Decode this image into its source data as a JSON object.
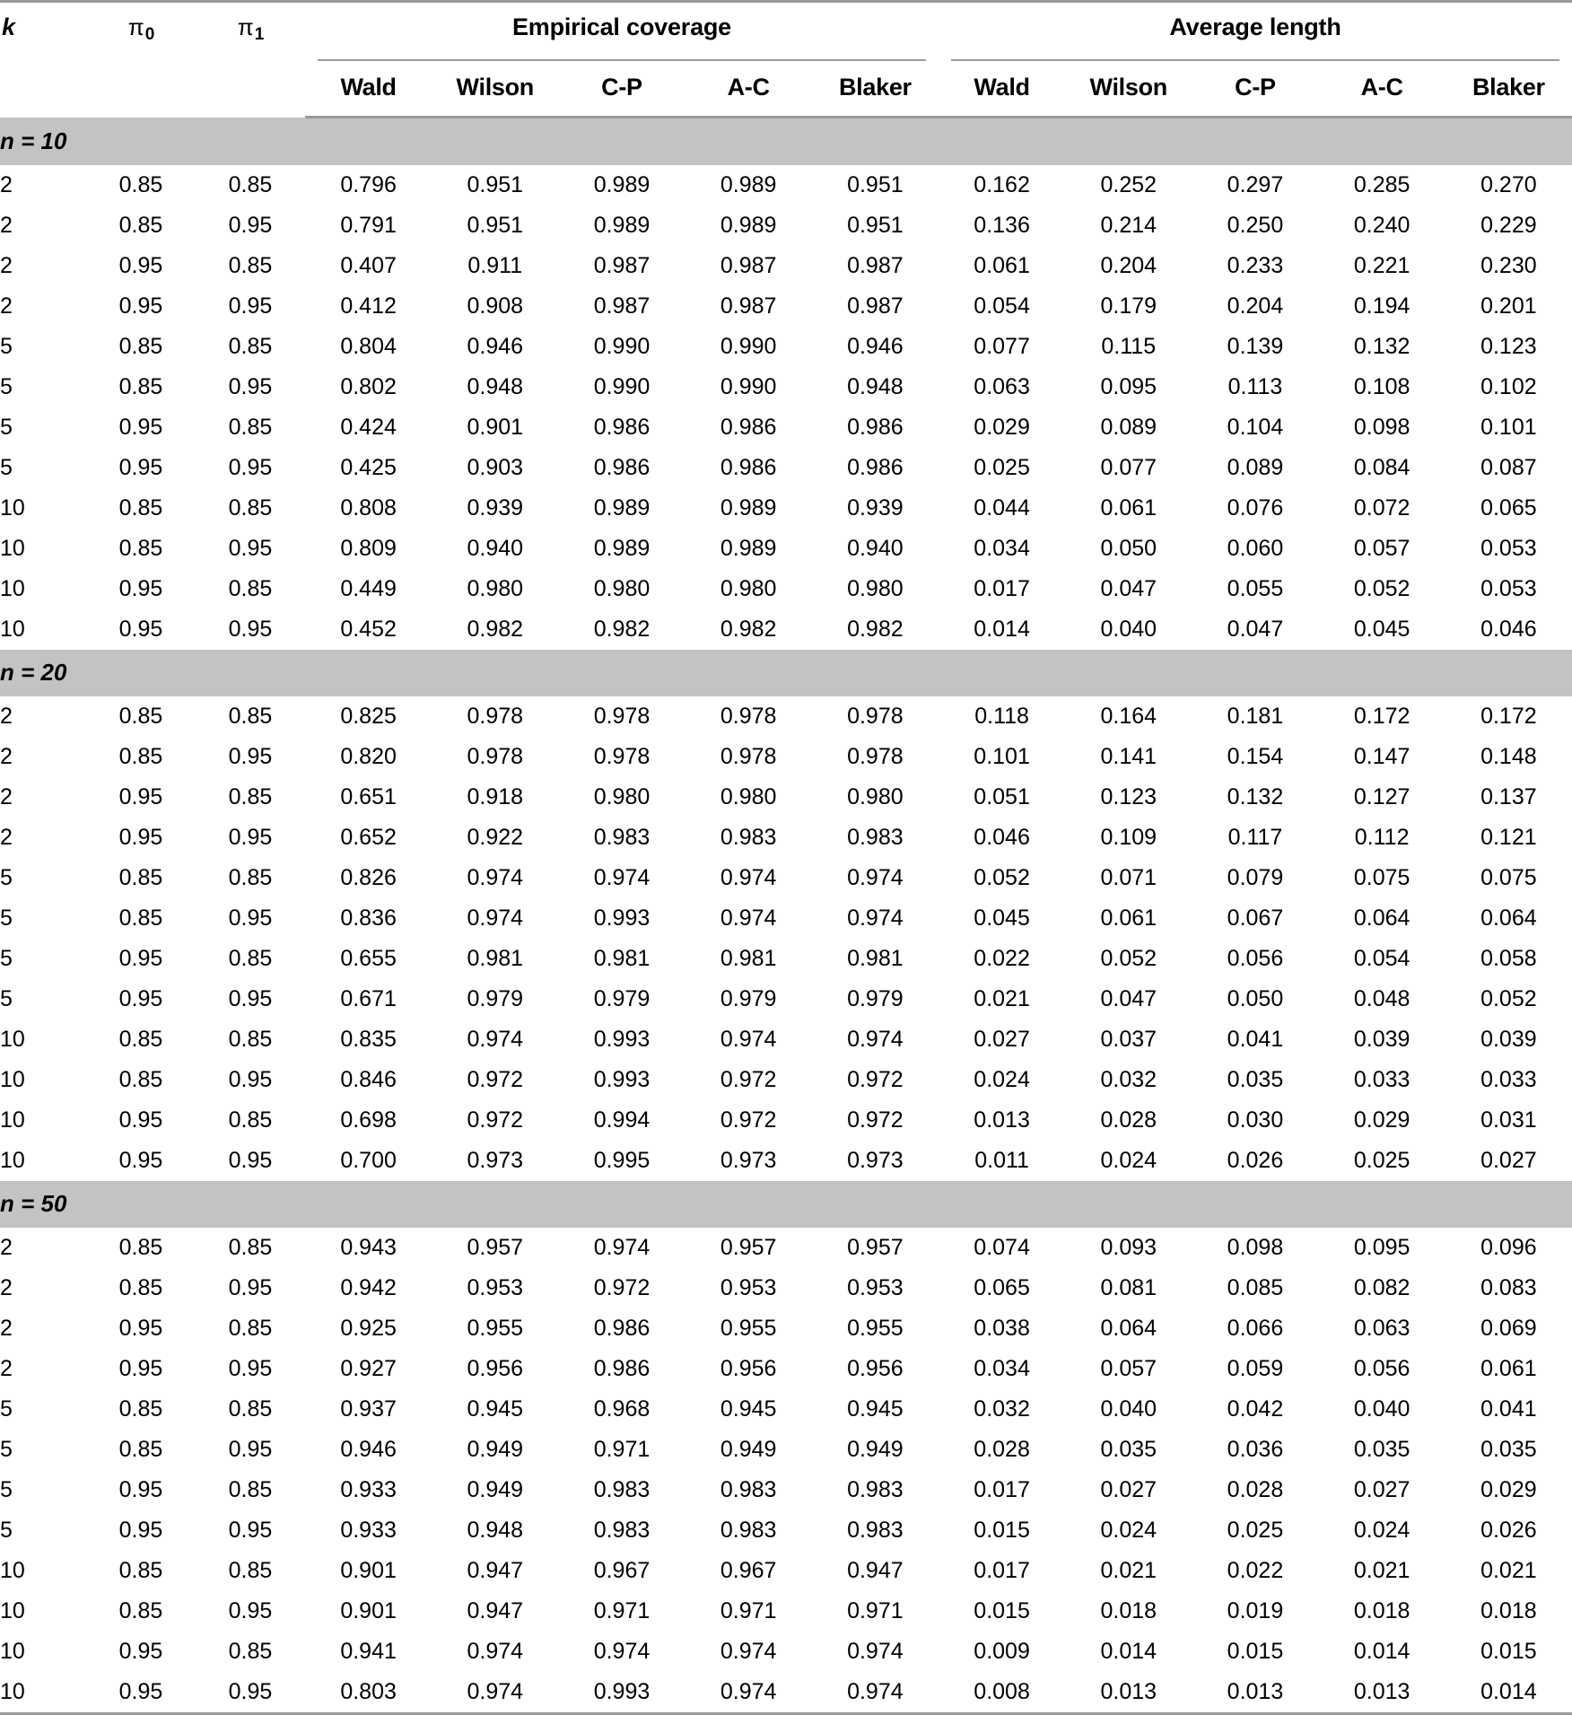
{
  "table": {
    "stub_headers": [
      {
        "label": "k",
        "style": "italic"
      },
      {
        "label": "π",
        "sub": "0"
      },
      {
        "label": "π",
        "sub": "1"
      }
    ],
    "group_headers": [
      {
        "label": "Empirical coverage",
        "span": 5
      },
      {
        "label": "Average length",
        "span": 5
      }
    ],
    "method_headers": [
      "Wald",
      "Wilson",
      "C-P",
      "A-C",
      "Blaker",
      "Wald",
      "Wilson",
      "C-P",
      "A-C",
      "Blaker"
    ],
    "colors": {
      "section_band": "#c3c3c3",
      "rule": "#9a9a9a",
      "text": "#000000",
      "background": "#ffffff"
    },
    "sections": [
      {
        "label": "n = 10",
        "label_var": "n",
        "label_value": "10",
        "rows": [
          {
            "k": "2",
            "p0": "0.85",
            "p1": "0.85",
            "cov": [
              "0.796",
              "0.951",
              "0.989",
              "0.989",
              "0.951"
            ],
            "len": [
              "0.162",
              "0.252",
              "0.297",
              "0.285",
              "0.270"
            ]
          },
          {
            "k": "2",
            "p0": "0.85",
            "p1": "0.95",
            "cov": [
              "0.791",
              "0.951",
              "0.989",
              "0.989",
              "0.951"
            ],
            "len": [
              "0.136",
              "0.214",
              "0.250",
              "0.240",
              "0.229"
            ]
          },
          {
            "k": "2",
            "p0": "0.95",
            "p1": "0.85",
            "cov": [
              "0.407",
              "0.911",
              "0.987",
              "0.987",
              "0.987"
            ],
            "len": [
              "0.061",
              "0.204",
              "0.233",
              "0.221",
              "0.230"
            ]
          },
          {
            "k": "2",
            "p0": "0.95",
            "p1": "0.95",
            "cov": [
              "0.412",
              "0.908",
              "0.987",
              "0.987",
              "0.987"
            ],
            "len": [
              "0.054",
              "0.179",
              "0.204",
              "0.194",
              "0.201"
            ]
          },
          {
            "k": "5",
            "p0": "0.85",
            "p1": "0.85",
            "cov": [
              "0.804",
              "0.946",
              "0.990",
              "0.990",
              "0.946"
            ],
            "len": [
              "0.077",
              "0.115",
              "0.139",
              "0.132",
              "0.123"
            ]
          },
          {
            "k": "5",
            "p0": "0.85",
            "p1": "0.95",
            "cov": [
              "0.802",
              "0.948",
              "0.990",
              "0.990",
              "0.948"
            ],
            "len": [
              "0.063",
              "0.095",
              "0.113",
              "0.108",
              "0.102"
            ]
          },
          {
            "k": "5",
            "p0": "0.95",
            "p1": "0.85",
            "cov": [
              "0.424",
              "0.901",
              "0.986",
              "0.986",
              "0.986"
            ],
            "len": [
              "0.029",
              "0.089",
              "0.104",
              "0.098",
              "0.101"
            ]
          },
          {
            "k": "5",
            "p0": "0.95",
            "p1": "0.95",
            "cov": [
              "0.425",
              "0.903",
              "0.986",
              "0.986",
              "0.986"
            ],
            "len": [
              "0.025",
              "0.077",
              "0.089",
              "0.084",
              "0.087"
            ]
          },
          {
            "k": "10",
            "p0": "0.85",
            "p1": "0.85",
            "cov": [
              "0.808",
              "0.939",
              "0.989",
              "0.989",
              "0.939"
            ],
            "len": [
              "0.044",
              "0.061",
              "0.076",
              "0.072",
              "0.065"
            ]
          },
          {
            "k": "10",
            "p0": "0.85",
            "p1": "0.95",
            "cov": [
              "0.809",
              "0.940",
              "0.989",
              "0.989",
              "0.940"
            ],
            "len": [
              "0.034",
              "0.050",
              "0.060",
              "0.057",
              "0.053"
            ]
          },
          {
            "k": "10",
            "p0": "0.95",
            "p1": "0.85",
            "cov": [
              "0.449",
              "0.980",
              "0.980",
              "0.980",
              "0.980"
            ],
            "len": [
              "0.017",
              "0.047",
              "0.055",
              "0.052",
              "0.053"
            ]
          },
          {
            "k": "10",
            "p0": "0.95",
            "p1": "0.95",
            "cov": [
              "0.452",
              "0.982",
              "0.982",
              "0.982",
              "0.982"
            ],
            "len": [
              "0.014",
              "0.040",
              "0.047",
              "0.045",
              "0.046"
            ]
          }
        ]
      },
      {
        "label": "n = 20",
        "label_var": "n",
        "label_value": "20",
        "rows": [
          {
            "k": "2",
            "p0": "0.85",
            "p1": "0.85",
            "cov": [
              "0.825",
              "0.978",
              "0.978",
              "0.978",
              "0.978"
            ],
            "len": [
              "0.118",
              "0.164",
              "0.181",
              "0.172",
              "0.172"
            ]
          },
          {
            "k": "2",
            "p0": "0.85",
            "p1": "0.95",
            "cov": [
              "0.820",
              "0.978",
              "0.978",
              "0.978",
              "0.978"
            ],
            "len": [
              "0.101",
              "0.141",
              "0.154",
              "0.147",
              "0.148"
            ]
          },
          {
            "k": "2",
            "p0": "0.95",
            "p1": "0.85",
            "cov": [
              "0.651",
              "0.918",
              "0.980",
              "0.980",
              "0.980"
            ],
            "len": [
              "0.051",
              "0.123",
              "0.132",
              "0.127",
              "0.137"
            ]
          },
          {
            "k": "2",
            "p0": "0.95",
            "p1": "0.95",
            "cov": [
              "0.652",
              "0.922",
              "0.983",
              "0.983",
              "0.983"
            ],
            "len": [
              "0.046",
              "0.109",
              "0.117",
              "0.112",
              "0.121"
            ]
          },
          {
            "k": "5",
            "p0": "0.85",
            "p1": "0.85",
            "cov": [
              "0.826",
              "0.974",
              "0.974",
              "0.974",
              "0.974"
            ],
            "len": [
              "0.052",
              "0.071",
              "0.079",
              "0.075",
              "0.075"
            ]
          },
          {
            "k": "5",
            "p0": "0.85",
            "p1": "0.95",
            "cov": [
              "0.836",
              "0.974",
              "0.993",
              "0.974",
              "0.974"
            ],
            "len": [
              "0.045",
              "0.061",
              "0.067",
              "0.064",
              "0.064"
            ]
          },
          {
            "k": "5",
            "p0": "0.95",
            "p1": "0.85",
            "cov": [
              "0.655",
              "0.981",
              "0.981",
              "0.981",
              "0.981"
            ],
            "len": [
              "0.022",
              "0.052",
              "0.056",
              "0.054",
              "0.058"
            ]
          },
          {
            "k": "5",
            "p0": "0.95",
            "p1": "0.95",
            "cov": [
              "0.671",
              "0.979",
              "0.979",
              "0.979",
              "0.979"
            ],
            "len": [
              "0.021",
              "0.047",
              "0.050",
              "0.048",
              "0.052"
            ]
          },
          {
            "k": "10",
            "p0": "0.85",
            "p1": "0.85",
            "cov": [
              "0.835",
              "0.974",
              "0.993",
              "0.974",
              "0.974"
            ],
            "len": [
              "0.027",
              "0.037",
              "0.041",
              "0.039",
              "0.039"
            ]
          },
          {
            "k": "10",
            "p0": "0.85",
            "p1": "0.95",
            "cov": [
              "0.846",
              "0.972",
              "0.993",
              "0.972",
              "0.972"
            ],
            "len": [
              "0.024",
              "0.032",
              "0.035",
              "0.033",
              "0.033"
            ]
          },
          {
            "k": "10",
            "p0": "0.95",
            "p1": "0.85",
            "cov": [
              "0.698",
              "0.972",
              "0.994",
              "0.972",
              "0.972"
            ],
            "len": [
              "0.013",
              "0.028",
              "0.030",
              "0.029",
              "0.031"
            ]
          },
          {
            "k": "10",
            "p0": "0.95",
            "p1": "0.95",
            "cov": [
              "0.700",
              "0.973",
              "0.995",
              "0.973",
              "0.973"
            ],
            "len": [
              "0.011",
              "0.024",
              "0.026",
              "0.025",
              "0.027"
            ]
          }
        ]
      },
      {
        "label": "n = 50",
        "label_var": "n",
        "label_value": "50",
        "rows": [
          {
            "k": "2",
            "p0": "0.85",
            "p1": "0.85",
            "cov": [
              "0.943",
              "0.957",
              "0.974",
              "0.957",
              "0.957"
            ],
            "len": [
              "0.074",
              "0.093",
              "0.098",
              "0.095",
              "0.096"
            ]
          },
          {
            "k": "2",
            "p0": "0.85",
            "p1": "0.95",
            "cov": [
              "0.942",
              "0.953",
              "0.972",
              "0.953",
              "0.953"
            ],
            "len": [
              "0.065",
              "0.081",
              "0.085",
              "0.082",
              "0.083"
            ]
          },
          {
            "k": "2",
            "p0": "0.95",
            "p1": "0.85",
            "cov": [
              "0.925",
              "0.955",
              "0.986",
              "0.955",
              "0.955"
            ],
            "len": [
              "0.038",
              "0.064",
              "0.066",
              "0.063",
              "0.069"
            ]
          },
          {
            "k": "2",
            "p0": "0.95",
            "p1": "0.95",
            "cov": [
              "0.927",
              "0.956",
              "0.986",
              "0.956",
              "0.956"
            ],
            "len": [
              "0.034",
              "0.057",
              "0.059",
              "0.056",
              "0.061"
            ]
          },
          {
            "k": "5",
            "p0": "0.85",
            "p1": "0.85",
            "cov": [
              "0.937",
              "0.945",
              "0.968",
              "0.945",
              "0.945"
            ],
            "len": [
              "0.032",
              "0.040",
              "0.042",
              "0.040",
              "0.041"
            ]
          },
          {
            "k": "5",
            "p0": "0.85",
            "p1": "0.95",
            "cov": [
              "0.946",
              "0.949",
              "0.971",
              "0.949",
              "0.949"
            ],
            "len": [
              "0.028",
              "0.035",
              "0.036",
              "0.035",
              "0.035"
            ]
          },
          {
            "k": "5",
            "p0": "0.95",
            "p1": "0.85",
            "cov": [
              "0.933",
              "0.949",
              "0.983",
              "0.983",
              "0.983"
            ],
            "len": [
              "0.017",
              "0.027",
              "0.028",
              "0.027",
              "0.029"
            ]
          },
          {
            "k": "5",
            "p0": "0.95",
            "p1": "0.95",
            "cov": [
              "0.933",
              "0.948",
              "0.983",
              "0.983",
              "0.983"
            ],
            "len": [
              "0.015",
              "0.024",
              "0.025",
              "0.024",
              "0.026"
            ]
          },
          {
            "k": "10",
            "p0": "0.85",
            "p1": "0.85",
            "cov": [
              "0.901",
              "0.947",
              "0.967",
              "0.967",
              "0.947"
            ],
            "len": [
              "0.017",
              "0.021",
              "0.022",
              "0.021",
              "0.021"
            ]
          },
          {
            "k": "10",
            "p0": "0.85",
            "p1": "0.95",
            "cov": [
              "0.901",
              "0.947",
              "0.971",
              "0.971",
              "0.971"
            ],
            "len": [
              "0.015",
              "0.018",
              "0.019",
              "0.018",
              "0.018"
            ]
          },
          {
            "k": "10",
            "p0": "0.95",
            "p1": "0.85",
            "cov": [
              "0.941",
              "0.974",
              "0.974",
              "0.974",
              "0.974"
            ],
            "len": [
              "0.009",
              "0.014",
              "0.015",
              "0.014",
              "0.015"
            ]
          },
          {
            "k": "10",
            "p0": "0.95",
            "p1": "0.95",
            "cov": [
              "0.803",
              "0.974",
              "0.993",
              "0.974",
              "0.974"
            ],
            "len": [
              "0.008",
              "0.013",
              "0.013",
              "0.013",
              "0.014"
            ]
          }
        ]
      }
    ]
  }
}
